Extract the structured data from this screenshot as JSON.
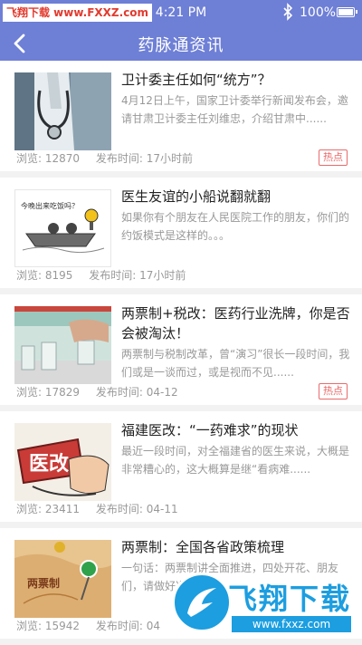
{
  "status_bar": {
    "watermark": "飞翔下载 www.FXXZ.com",
    "time": "4:21 PM",
    "battery": "100%",
    "icons": [
      "bluetooth-icon",
      "battery-icon"
    ]
  },
  "nav": {
    "back_icon": "back-chevron-icon",
    "title": "药脉通资讯"
  },
  "labels": {
    "views": "浏览:",
    "published": "发布时间:",
    "hot": "热点"
  },
  "articles": [
    {
      "title": "卫计委主任如何“统方”？",
      "summary": "4月12日上午，国家卫计委举行新闻发布会，邀请甘肃卫计委主任刘维忠，介绍甘肃中......",
      "views": "12870",
      "time": "17小时前",
      "hot": true
    },
    {
      "title": "医生友谊的小船说翻就翻",
      "summary": "如果你有个朋友在人民医院工作的朋友，你们的约饭模式是这样的。。。",
      "thumb_caption": "今晚出来吃饭吗？",
      "views": "8195",
      "time": "17小时前",
      "hot": false
    },
    {
      "title": "两票制+税改：医药行业洗牌，你是否会被淘汰！",
      "summary": "两票制与税制改革，曾“演习”很长一段时间，我们或是一谈而过，或是视而不见......",
      "views": "17829",
      "time": "04-12",
      "hot": true
    },
    {
      "title": "福建医改：“一药难求”的现状",
      "summary": "最近一段时间，对全福建省的医生来说，大概是非常糟心的，这大概算是继“看病难......",
      "thumb_caption": "医改",
      "views": "23411",
      "time": "04-11",
      "hot": false
    },
    {
      "title": "两票制：全国各省政策梳理",
      "summary": "一句话：两票制讲全面推进，四处开花、朋友们，请做好准备……",
      "thumb_caption": "两票制",
      "views": "15942",
      "time": "04",
      "hot": false
    }
  ],
  "watermark": {
    "text": "飞翔下载",
    "url": "www.fxxz.com"
  },
  "colors": {
    "header": "#6e7fd6",
    "hot": "#e96a6a",
    "watermark": "#1c9ee0"
  }
}
